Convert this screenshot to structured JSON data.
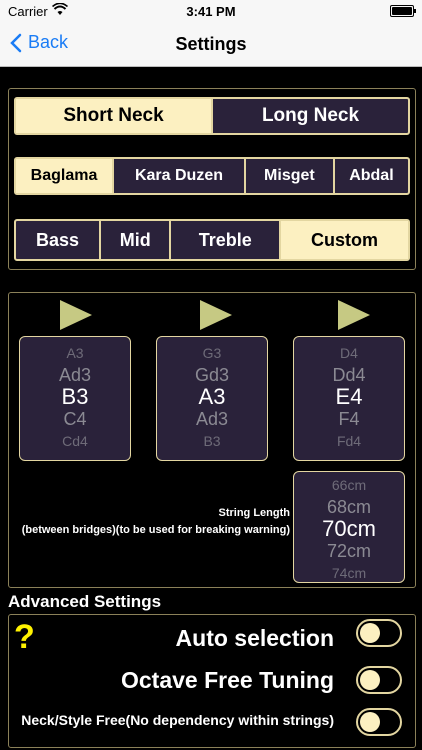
{
  "status": {
    "carrier": "Carrier",
    "time": "3:41 PM"
  },
  "nav": {
    "back_label": "Back",
    "title": "Settings"
  },
  "neck": {
    "options": [
      "Short Neck",
      "Long Neck"
    ],
    "selected": "Short Neck"
  },
  "tuning_style": {
    "options": [
      "Baglama",
      "Kara Duzen",
      "Misget",
      "Abdal"
    ],
    "selected": "Baglama"
  },
  "string_group": {
    "options": [
      "Bass",
      "Mid",
      "Treble",
      "Custom"
    ],
    "selected": "Custom"
  },
  "pickers": [
    {
      "rows": [
        "A3",
        "Ad3",
        "B3",
        "C4",
        "Cd4"
      ],
      "selected": "B3"
    },
    {
      "rows": [
        "G3",
        "Gd3",
        "A3",
        "Ad3",
        "B3"
      ],
      "selected": "A3"
    },
    {
      "rows": [
        "D4",
        "Dd4",
        "E4",
        "F4",
        "Fd4"
      ],
      "selected": "E4"
    }
  ],
  "string_length": {
    "label_line1": "String Length",
    "label_line2": "(between bridges)(to be used for breaking warning)",
    "rows": [
      "66cm",
      "68cm",
      "70cm",
      "72cm",
      "74cm"
    ],
    "selected": "70cm"
  },
  "advanced": {
    "title": "Advanced Settings",
    "help": "?",
    "toggles": [
      {
        "label": "Auto selection",
        "on": false
      },
      {
        "label": "Octave Free Tuning",
        "on": false
      },
      {
        "label": "Neck/Style Free(No dependency within strings)",
        "on": false
      }
    ]
  }
}
